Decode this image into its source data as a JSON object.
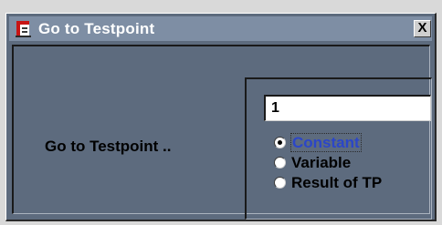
{
  "window": {
    "title": "Go to Testpoint",
    "close_label": "X"
  },
  "dialog": {
    "prompt": "Go to Testpoint ..",
    "input_value": "1",
    "radio_options": [
      {
        "label": "Constant",
        "selected": true
      },
      {
        "label": "Variable",
        "selected": false
      },
      {
        "label": "Result of TP",
        "selected": false
      }
    ]
  },
  "icons": {
    "title_icon": "app-window-icon",
    "close_icon": "close-icon"
  },
  "colors": {
    "window_bg": "#5d6b7e",
    "titlebar_bg": "#7e8ea4",
    "title_text": "#ffffff",
    "selected_option_text": "#2b46c8",
    "input_bg": "#ffffff"
  }
}
